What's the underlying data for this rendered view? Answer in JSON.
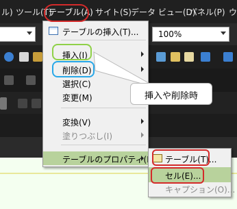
{
  "menubar": {
    "items": [
      {
        "label": "ル)"
      },
      {
        "label": "ツール(T)"
      },
      {
        "label": "テーブル(A)"
      },
      {
        "label": "サイト(S)"
      },
      {
        "label": "データ ビュー(D)"
      },
      {
        "label": "パネル(P)"
      },
      {
        "label": "ウ"
      }
    ]
  },
  "toolbar": {
    "zoom_value": "100%"
  },
  "table_menu": {
    "items": [
      {
        "label": "テーブルの挿入(T)...",
        "submenu": false,
        "enabled": true
      },
      {
        "label": "挿入(I)",
        "submenu": true,
        "enabled": true
      },
      {
        "label": "削除(D)",
        "submenu": true,
        "enabled": true
      },
      {
        "label": "選択(C)",
        "submenu": true,
        "enabled": true
      },
      {
        "label": "変更(M)",
        "submenu": false,
        "enabled": true
      },
      {
        "label": "変換(V)",
        "submenu": true,
        "enabled": true
      },
      {
        "label": "塗りつぶし(I)",
        "submenu": true,
        "enabled": false
      },
      {
        "label": "テーブルのプロパティ(R)",
        "submenu": true,
        "enabled": true,
        "highlighted": true
      }
    ]
  },
  "properties_submenu": {
    "items": [
      {
        "label": "テーブル(T)...",
        "enabled": true
      },
      {
        "label": "セル(E)...",
        "enabled": true,
        "highlighted": true
      },
      {
        "label": "キャプション(O)...",
        "enabled": false
      }
    ]
  },
  "callout": {
    "text": "挿入や削除時"
  },
  "colors": {
    "menu_bg": "#f0f0f0",
    "highlight": "#b8d29c",
    "annotation_red": "#d42a2a",
    "annotation_green": "#8fd148",
    "annotation_blue": "#27a7e8"
  }
}
